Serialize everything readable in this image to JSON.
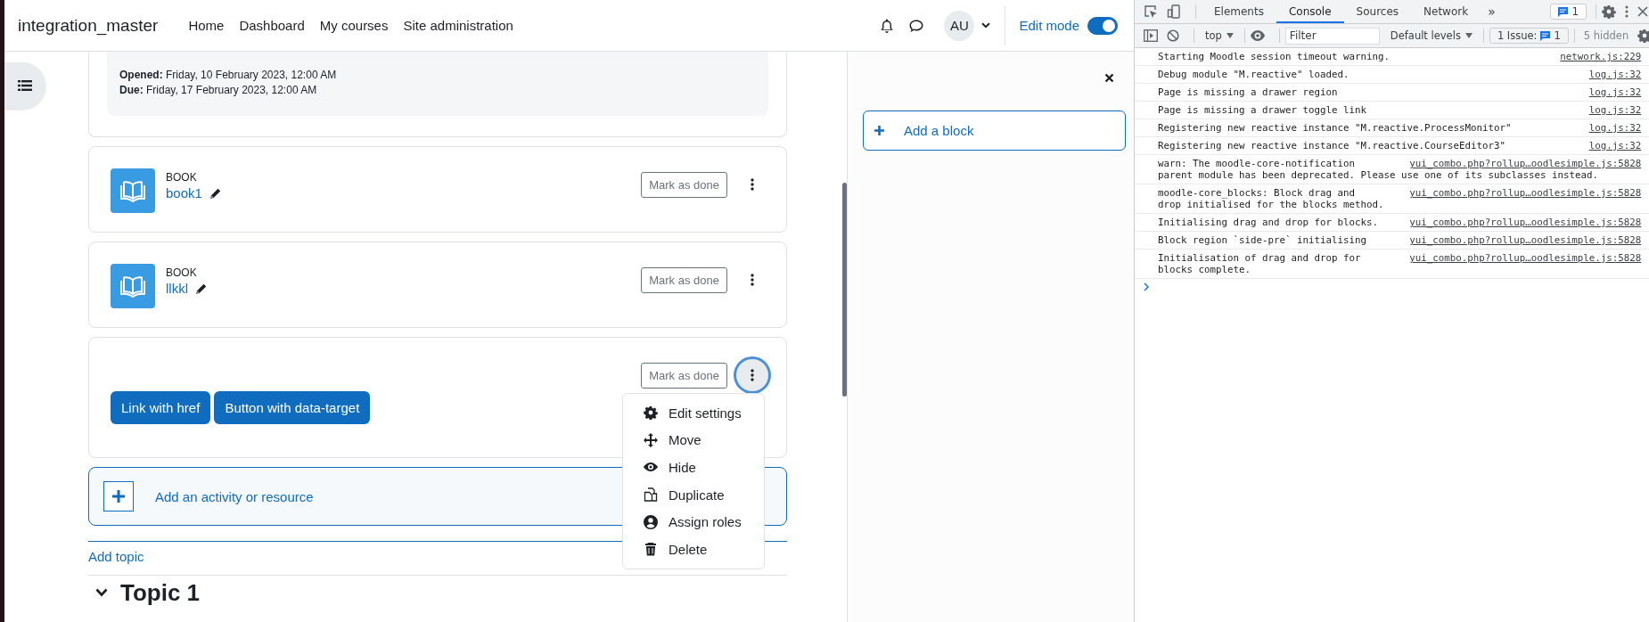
{
  "navbar": {
    "site_name": "integration_master",
    "links": [
      "Home",
      "Dashboard",
      "My courses",
      "Site administration"
    ],
    "user_initials": "AU",
    "edit_mode": {
      "label": "Edit mode",
      "on": true
    }
  },
  "assignment_dates": [
    {
      "label": "Opened:",
      "value": "Friday, 10 February 2023, 12:00 AM"
    },
    {
      "label": "Due:",
      "value": "Friday, 17 February 2023, 12:00 AM"
    }
  ],
  "activities": [
    {
      "kind": "book",
      "type_label": "BOOK",
      "name": "book1",
      "completion": "Mark as done",
      "menu_open": false
    },
    {
      "kind": "book",
      "type_label": "BOOK",
      "name": "llkkl",
      "completion": "Mark as done",
      "menu_open": false
    },
    {
      "kind": "buttons",
      "buttons": [
        "Link with href",
        "Button with data-target"
      ],
      "completion": "Mark as done",
      "menu_open": true
    }
  ],
  "action_menu": [
    "Edit settings",
    "Move",
    "Hide",
    "Duplicate",
    "Assign roles",
    "Delete"
  ],
  "add_activity": "Add an activity or resource",
  "add_topic": "Add topic",
  "topic": {
    "title": "Topic 1"
  },
  "block_drawer": {
    "add_block": "Add a block"
  },
  "devtools": {
    "tabs": [
      {
        "label": "Elements",
        "selected": false
      },
      {
        "label": "Console",
        "selected": true
      },
      {
        "label": "Sources",
        "selected": false
      },
      {
        "label": "Network",
        "selected": false
      }
    ],
    "more_tabs": "»",
    "message_badge": "1",
    "context": "top",
    "filter_placeholder": "Filter",
    "levels": "Default levels",
    "issues_label": "1 Issue:",
    "issues_count": "1",
    "hidden": "5 hidden",
    "messages": [
      {
        "text": "Starting Moodle session timeout warning.",
        "source": "network.js:229"
      },
      {
        "text": "Debug module \"M.reactive\" loaded.",
        "source": "log.js:32"
      },
      {
        "text": "Page is missing a drawer region",
        "source": "log.js:32"
      },
      {
        "text": "Page is missing a drawer toggle link",
        "source": "log.js:32"
      },
      {
        "text": "Registering new reactive instance \"M.reactive.ProcessMonitor\"",
        "source": "log.js:32"
      },
      {
        "text": "Registering new reactive instance \"M.reactive.CourseEditor3\"",
        "source": "log.js:32"
      },
      {
        "text": "warn: The moodle-core-notification",
        "more_lines": [
          "parent module has been deprecated. Please use one of its subclasses instead."
        ],
        "source": "yui_combo.php?rollup…oodlesimple.js:5828"
      },
      {
        "text": "moodle-core_blocks: Block drag and",
        "more_lines": [
          "drop initialised for the blocks method."
        ],
        "source": "yui_combo.php?rollup…oodlesimple.js:5828"
      },
      {
        "text": "Initialising drag and drop for blocks.",
        "source": "yui_combo.php?rollup…oodlesimple.js:5828"
      },
      {
        "text": "Block region `side-pre` initialising",
        "source": "yui_combo.php?rollup…oodlesimple.js:5828"
      },
      {
        "text": "Initialisation of drag and drop for",
        "more_lines": [
          "blocks complete."
        ],
        "source": "yui_combo.php?rollup…oodlesimple.js:5828"
      }
    ]
  }
}
